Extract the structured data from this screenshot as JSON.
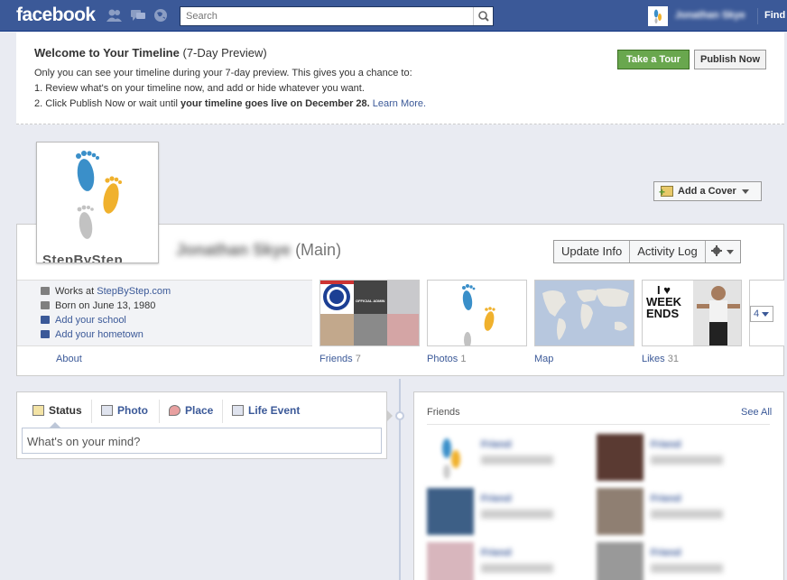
{
  "topbar": {
    "logo": "facebook",
    "search_placeholder": "Search",
    "user_name": "Jonathan Skye",
    "find_link": "Find"
  },
  "banner": {
    "title": "Welcome to Your Timeline",
    "title_suffix": "(7-Day Preview)",
    "line1": "Only you can see your timeline during your 7-day preview. This gives you a chance to:",
    "line2": "1. Review what's on your timeline now, and add or hide whatever you want.",
    "line3_prefix": "2. Click Publish Now or wait until ",
    "line3_bold": "your timeline goes live on December 28.",
    "line3_link": "Learn More.",
    "take_tour": "Take a Tour",
    "publish_now": "Publish Now"
  },
  "cover": {
    "add_cover": "Add a Cover",
    "profile_pic_text": "StepByStep"
  },
  "profile": {
    "name": "Jonathan Skye",
    "name_suffix": "(Main)",
    "update_info": "Update Info",
    "activity_log": "Activity Log",
    "settings_icon": "gear-icon"
  },
  "about": {
    "works_prefix": "Works at ",
    "works_link": "StepByStep.com",
    "born": "Born on June 13, 1980",
    "add_school": "Add your school",
    "add_hometown": "Add your hometown",
    "label": "About"
  },
  "tiles": {
    "friends_label": "Friends",
    "friends_count": "7",
    "photos_label": "Photos",
    "photos_count": "1",
    "map_label": "Map",
    "likes_label": "Likes",
    "likes_count": "31",
    "likes_text_top": "I ♥",
    "likes_text_mid": "WEEK",
    "likes_text_bot": "ENDS",
    "chelsea_text": "OFFICIAL ADMIN",
    "more_count": "4"
  },
  "composer": {
    "status": "Status",
    "photo": "Photo",
    "place": "Place",
    "life_event": "Life Event",
    "placeholder": "What's on your mind?"
  },
  "friends_box": {
    "title": "Friends",
    "see_all": "See All",
    "items": [
      "Friend",
      "Friend",
      "Friend",
      "Friend",
      "Friend",
      "Friend"
    ]
  },
  "colors": {
    "fb_blue": "#3b5998",
    "green_button": "#69a74e",
    "background": "#e9ebf2"
  }
}
